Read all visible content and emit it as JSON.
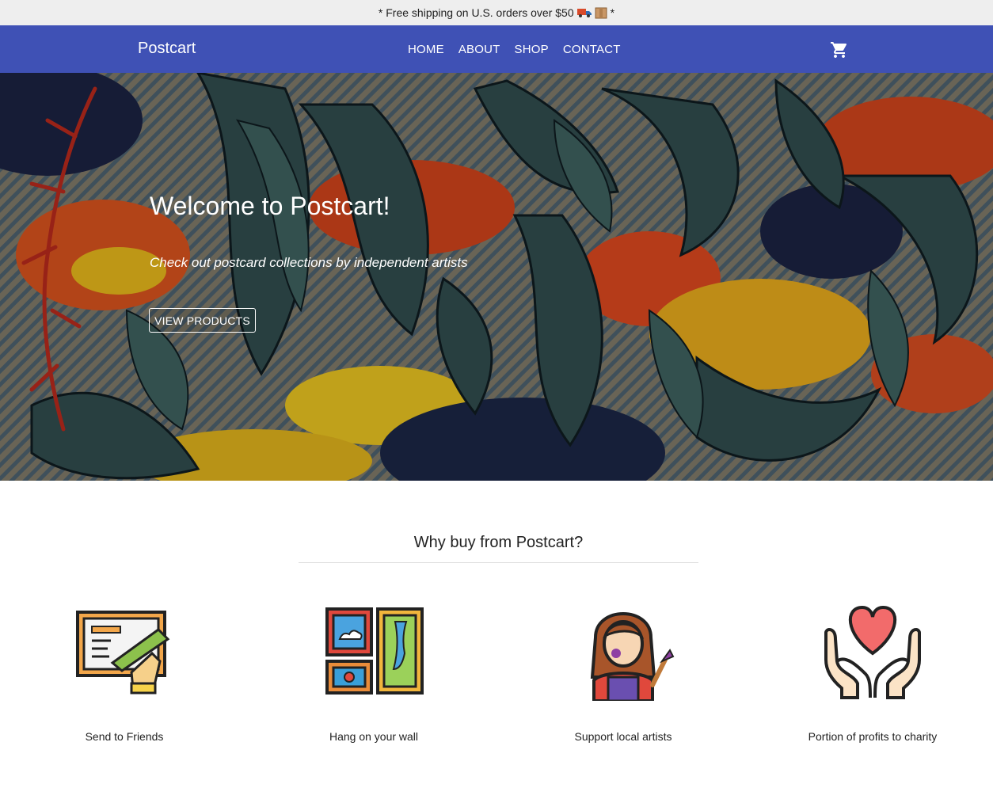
{
  "announcement": {
    "prefix": "* Free shipping on U.S. orders over $50",
    "suffix": "*",
    "icons": [
      "delivery-truck-icon",
      "package-icon"
    ]
  },
  "navbar": {
    "brand": "Postcart",
    "links": [
      "HOME",
      "ABOUT",
      "SHOP",
      "CONTACT"
    ],
    "cart_icon": "shopping-cart-icon",
    "color": "#3f51b5"
  },
  "hero": {
    "title": "Welcome to Postcart!",
    "subtitle": "Check out postcard collections by independent artists",
    "button": "VIEW PRODUCTS"
  },
  "why": {
    "title": "Why buy from Postcart?",
    "features": [
      {
        "label": "Send to Friends",
        "icon": "drawing-postcard-icon"
      },
      {
        "label": "Hang on your wall",
        "icon": "wall-frames-icon"
      },
      {
        "label": "Support local artists",
        "icon": "artist-icon"
      },
      {
        "label": "Portion of profits to charity",
        "icon": "charity-heart-hands-icon"
      }
    ]
  }
}
